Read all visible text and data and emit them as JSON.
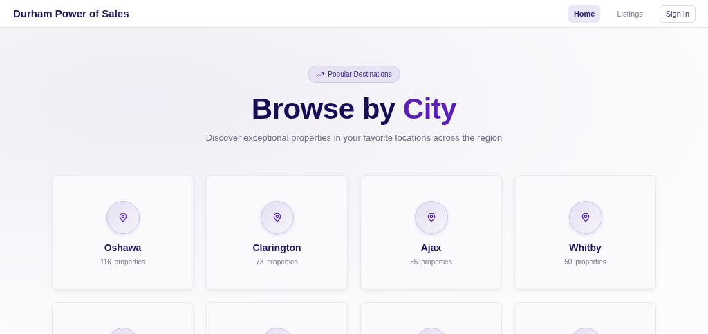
{
  "header": {
    "brand": "Durham Power of Sales",
    "nav": [
      {
        "label": "Home",
        "selected": true
      },
      {
        "label": "Listings",
        "selected": false
      }
    ],
    "sign_in": "Sign In"
  },
  "hero": {
    "badge": "Popular Destinations",
    "title": "Browse by **City**",
    "subtitle": "Discover exceptional properties in your favorite locations across the region"
  },
  "cities": [
    {
      "kind": "city",
      "name": "Oshawa",
      "count": "116 properties"
    },
    {
      "kind": "city",
      "name": "Clarington",
      "count": "73 properties"
    },
    {
      "kind": "city",
      "name": "Ajax",
      "count": "55 properties"
    },
    {
      "kind": "city",
      "name": "Whitby",
      "count": "50 properties"
    },
    {
      "kind": "cut_off"
    },
    {
      "kind": "cut_off"
    },
    {
      "kind": "cut_off"
    },
    {
      "kind": "cut_off"
    }
  ]
}
